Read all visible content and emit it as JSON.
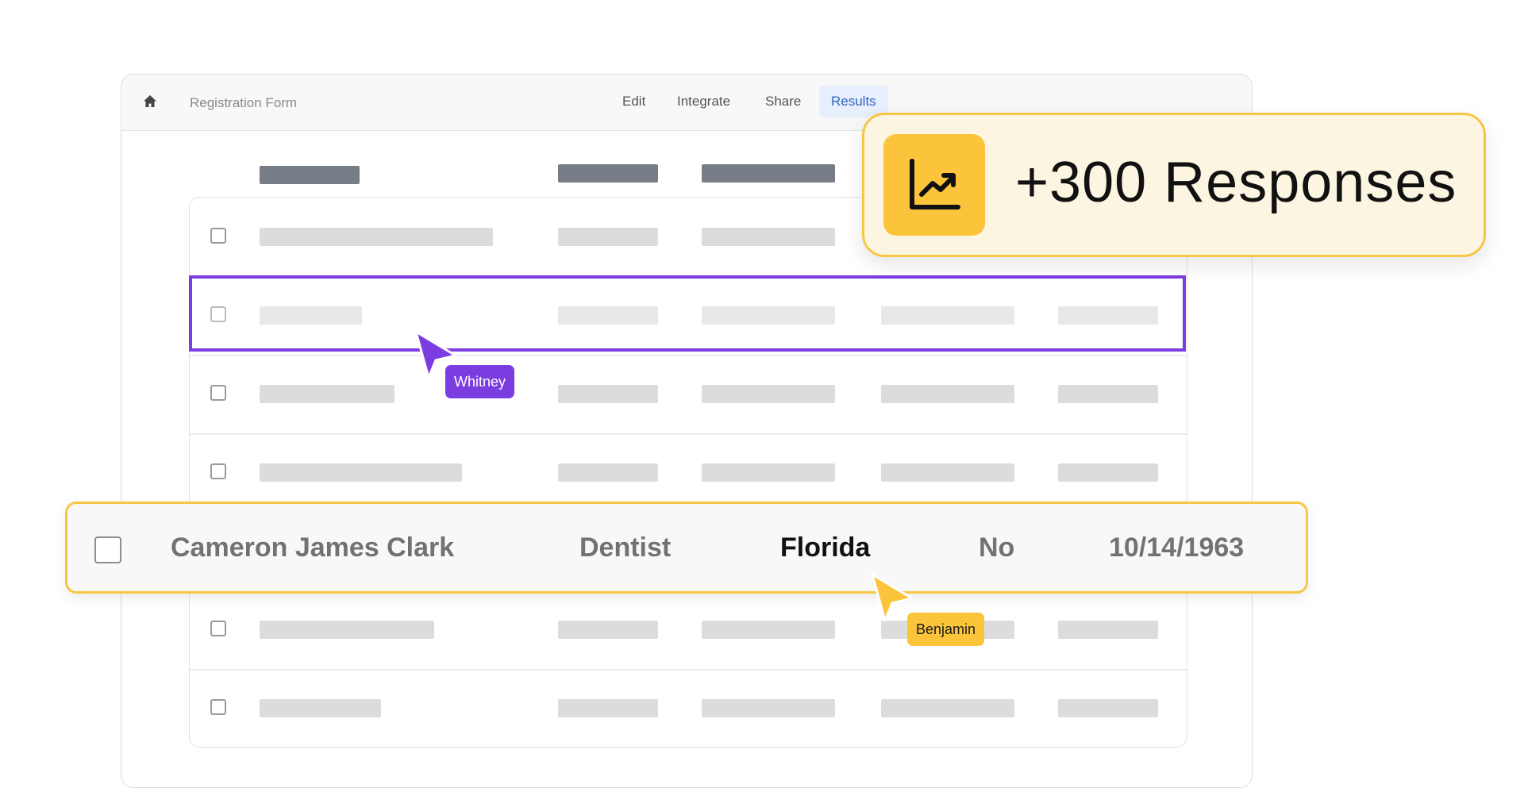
{
  "window": {
    "breadcrumb": "Registration Form",
    "nav": [
      "Edit",
      "Integrate",
      "Share",
      "Results"
    ],
    "active_tab": "Results",
    "icons": {
      "home": "home-icon"
    }
  },
  "table": {
    "row_count": 7,
    "placeholder_color": "#dcdcdc"
  },
  "collaborators": [
    {
      "name": "Whitney",
      "color": "#7b3ce0"
    },
    {
      "name": "Benjamin",
      "color": "#fbc43a"
    }
  ],
  "highlighted_record": {
    "name": "Cameron James Clark",
    "occupation": "Dentist",
    "state": "Florida",
    "answer": "No",
    "date": "10/14/1963"
  },
  "badge": {
    "text": "+300 Responses",
    "icon": "chart-trending-up-icon",
    "color": "#fbc43a"
  }
}
